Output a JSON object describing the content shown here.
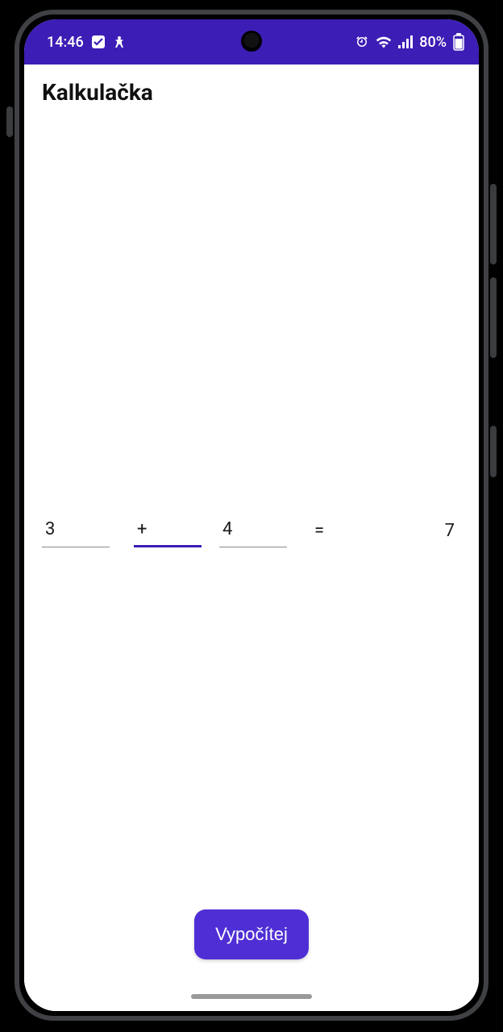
{
  "status": {
    "time": "14:46",
    "battery_pct": "80%"
  },
  "app": {
    "title": "Kalkulačka"
  },
  "calc": {
    "operand1": "3",
    "operator": "+",
    "operand2": "4",
    "equals": "=",
    "result": "7"
  },
  "action": {
    "compute_label": "Vypočítej"
  },
  "colors": {
    "accent": "#3C1DB5",
    "button": "#4F2FD5"
  }
}
